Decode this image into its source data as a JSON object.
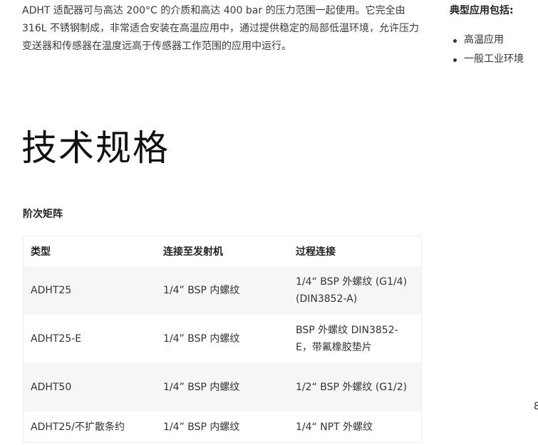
{
  "intro": {
    "text": "ADHT 适配器可与高达 200°C 的介质和高达 400 bar 的压力范围一起使用。它完全由 316L 不锈钢制成，非常适合安装在高温应用中，通过提供稳定的局部低温环境，允许压力变送器和传感器在温度远高于传感器工作范围的应用中运行。"
  },
  "sidebar": {
    "heading": "典型应用包括:",
    "items": [
      "高温应用",
      "一般工业环境"
    ],
    "edge_glyph": "8"
  },
  "section": {
    "title": "技术规格"
  },
  "table": {
    "caption": "阶次矩阵",
    "headers": [
      "类型",
      "连接至发射机",
      "过程连接"
    ],
    "rows": [
      {
        "type": "ADHT25",
        "transmitter": "1/4” BSP 内螺纹",
        "process": "1/4“ BSP 外螺纹 (G1/4) (DIN3852-A)"
      },
      {
        "type": "ADHT25-E",
        "transmitter": "1/4” BSP 内螺纹",
        "process": "BSP 外螺纹 DIN3852-E，带氟橡胶垫片"
      },
      {
        "type": "ADHT50",
        "transmitter": "1/4” BSP 内螺纹",
        "process": "1/2“ BSP 外螺纹 (G1/2)"
      },
      {
        "type": "ADHT25/不扩散条约",
        "transmitter": "1/4” BSP 内螺纹",
        "process": "1/4“ NPT 外螺纹"
      }
    ]
  }
}
